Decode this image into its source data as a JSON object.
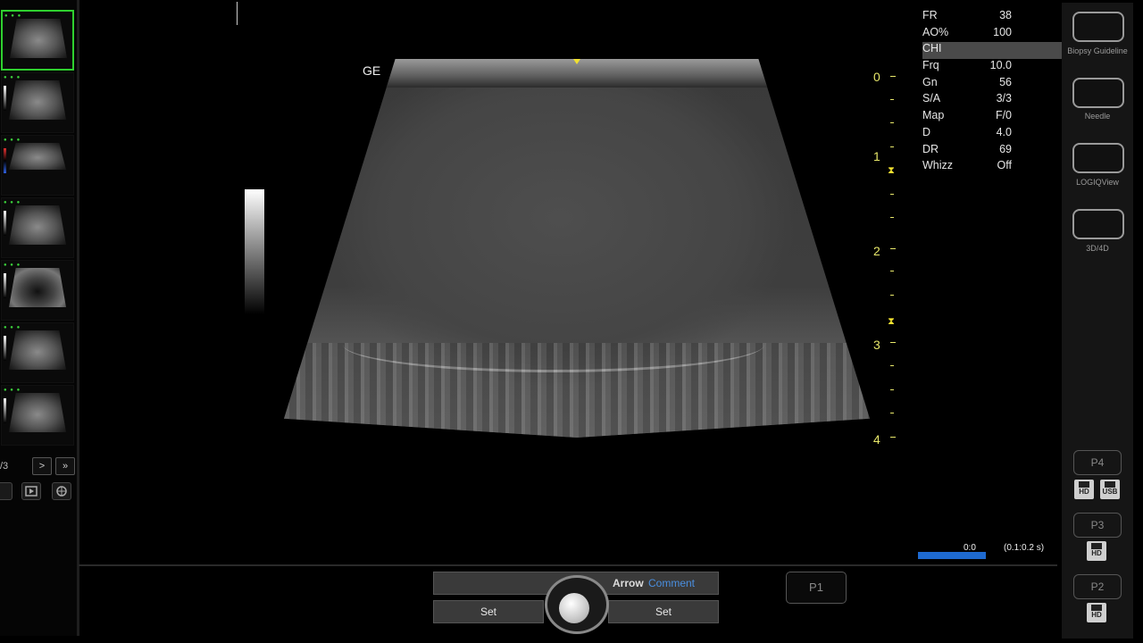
{
  "sidebar": {
    "page_indicator": "/3",
    "next_label": ">",
    "last_label": "»"
  },
  "image": {
    "brand_label": "GE",
    "depth_ticks": [
      "0",
      "1",
      "2",
      "3",
      "4"
    ]
  },
  "params": [
    {
      "label": "FR",
      "value": "38"
    },
    {
      "label": "AO%",
      "value": "100"
    },
    {
      "label": "CHI",
      "value": ""
    },
    {
      "label": "Frq",
      "value": "10.0"
    },
    {
      "label": "Gn",
      "value": "56"
    },
    {
      "label": "S/A",
      "value": "3/3"
    },
    {
      "label": "Map",
      "value": "F/0"
    },
    {
      "label": "D",
      "value": "4.0"
    },
    {
      "label": "DR",
      "value": "69"
    },
    {
      "label": "Whizz",
      "value": "Off"
    }
  ],
  "right_panel": {
    "buttons": [
      {
        "label": "Biopsy Guideline"
      },
      {
        "label": "Needle"
      },
      {
        "label": "LOGIQView"
      },
      {
        "label": "3D/4D"
      }
    ],
    "presets": [
      "P4",
      "P3",
      "P2"
    ],
    "storage": {
      "hd": "HD",
      "usb": "USB"
    }
  },
  "cine": {
    "count": "0:0",
    "speed": "(0.1:0.2 s)"
  },
  "bottom": {
    "arrow": "Arrow",
    "comment": "Comment",
    "set_left": "Set",
    "set_right": "Set",
    "p1": "P1"
  },
  "colors": {
    "accent_blue": "#1e6ad0",
    "depth_yellow": "#e7e76a",
    "selected_green": "#2fd02f",
    "comment_blue": "#4a8fe0"
  }
}
